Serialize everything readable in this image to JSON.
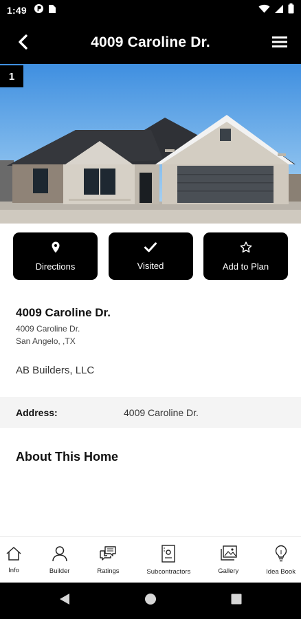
{
  "status_bar": {
    "time": "1:49",
    "left_icons": [
      "app-notification-icon",
      "sim-card-icon"
    ],
    "right_icons": [
      "wifi-icon",
      "cell-signal-icon",
      "battery-icon"
    ]
  },
  "app_bar": {
    "title": "4009 Caroline Dr.",
    "back_icon": "chevron-left-icon",
    "menu_icon": "hamburger-menu-icon"
  },
  "hero": {
    "photo_index": "1",
    "alt": "house photo"
  },
  "actions": [
    {
      "label": "Directions",
      "icon": "map-pin-icon"
    },
    {
      "label": "Visited",
      "icon": "checkmark-icon"
    },
    {
      "label": "Add to Plan",
      "icon": "star-icon"
    }
  ],
  "home": {
    "name": "4009 Caroline Dr.",
    "street": "4009 Caroline Dr.",
    "city_state": "San Angelo, ,TX",
    "builder": "AB Builders, LLC"
  },
  "details": {
    "address_label": "Address:",
    "address_value": "4009 Caroline Dr."
  },
  "about": {
    "heading": "About This Home"
  },
  "bottom_nav": [
    {
      "label": "Info",
      "icon": "home-icon"
    },
    {
      "label": "Builder",
      "icon": "person-icon"
    },
    {
      "label": "Ratings",
      "icon": "chat-bubbles-icon"
    },
    {
      "label": "Subcontractors",
      "icon": "id-badge-icon"
    },
    {
      "label": "Gallery",
      "icon": "gallery-icon"
    },
    {
      "label": "Idea Book",
      "icon": "lightbulb-icon"
    }
  ],
  "system_nav": [
    "back-triangle-icon",
    "home-circle-icon",
    "recents-square-icon"
  ],
  "colors": {
    "bar_background": "#000000",
    "button_background": "#000000",
    "detail_row_background": "#f4f4f4"
  }
}
